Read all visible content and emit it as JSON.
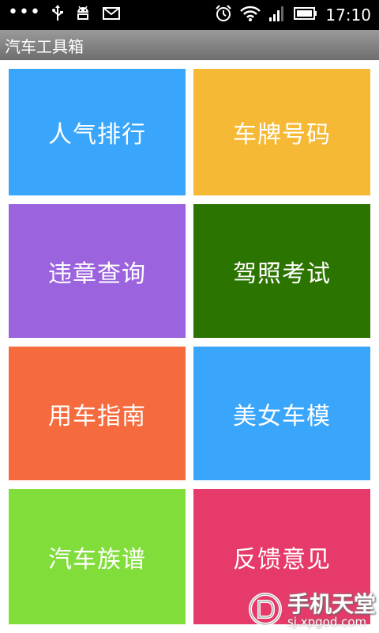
{
  "statusbar": {
    "dots": "•••",
    "time": "17:10",
    "icons": [
      "more-dots-icon",
      "usb-icon",
      "android-debug-icon",
      "mail-icon",
      "alarm-icon",
      "wifi-icon",
      "signal-icon",
      "battery-icon"
    ]
  },
  "app": {
    "title": "汽车工具箱"
  },
  "tiles": [
    {
      "label": "人气排行",
      "color": "#3aa6fb"
    },
    {
      "label": "车牌号码",
      "color": "#f5b935"
    },
    {
      "label": "违章查询",
      "color": "#9b63dd"
    },
    {
      "label": "驾照考试",
      "color": "#2c7400"
    },
    {
      "label": "用车指南",
      "color": "#f56b3e"
    },
    {
      "label": "美女车模",
      "color": "#3aa6fb"
    },
    {
      "label": "汽车族谱",
      "color": "#80dd3a"
    },
    {
      "label": "反馈意见",
      "color": "#e63b6a"
    }
  ],
  "watermark": {
    "title": "手机天堂",
    "url": "sj.xpgod.com"
  }
}
